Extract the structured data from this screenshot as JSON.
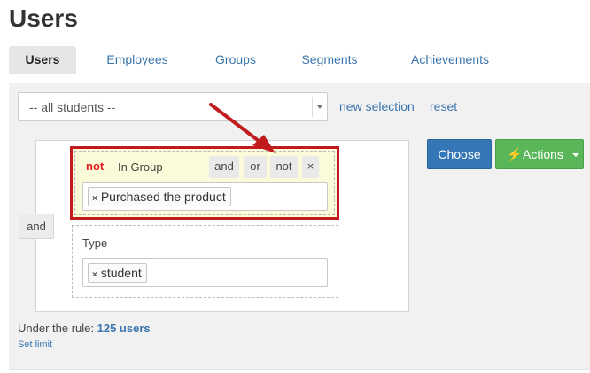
{
  "page": {
    "title": "Users"
  },
  "tabs": [
    {
      "label": "Users",
      "active": true
    },
    {
      "label": "Employees",
      "active": false
    },
    {
      "label": "Groups",
      "active": false
    },
    {
      "label": "Segments",
      "active": false
    },
    {
      "label": "Achievements",
      "active": false
    }
  ],
  "filter": {
    "selected": "-- all students --",
    "new_selection_label": "new selection",
    "reset_label": "reset"
  },
  "rules": {
    "combinator": "and",
    "conditions": [
      {
        "negated_label": "not",
        "title": "In Group",
        "operators": [
          "and",
          "or",
          "not"
        ],
        "close_glyph": "×",
        "tags": [
          "Purchased the product"
        ]
      },
      {
        "title": "Type",
        "tags": [
          "student"
        ]
      }
    ],
    "tag_remove_glyph": "×"
  },
  "actions": {
    "choose_label": "Choose",
    "actions_label": "Actions"
  },
  "summary": {
    "prefix": "Under the rule:",
    "count": "125 users",
    "set_limit_label": "Set limit"
  },
  "colors": {
    "link": "#3a75ad",
    "primary": "#3476b6",
    "success": "#59b759",
    "annotation_red": "#c01c20",
    "highlight_bg": "#fbfbd9"
  },
  "icons": {
    "actions": "lightning-bolt-icon",
    "select_caret": "chevron-down-icon",
    "tag_remove": "close-icon",
    "annotation": "arrow-annotation"
  }
}
